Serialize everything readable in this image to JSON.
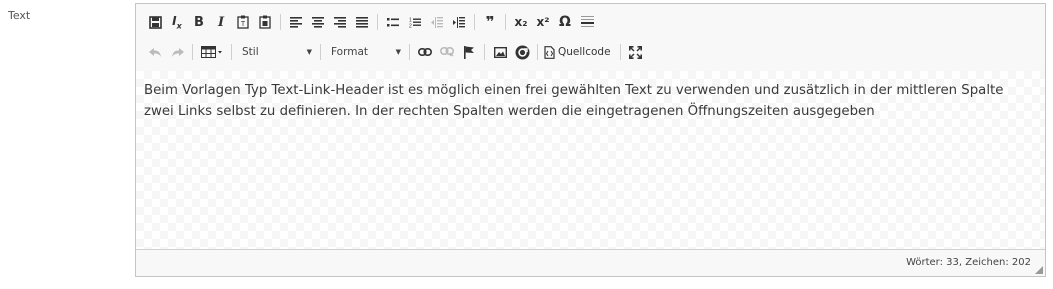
{
  "field": {
    "label": "Text"
  },
  "toolbar": {
    "row1": [
      {
        "name": "save-icon"
      },
      {
        "name": "remove-format-icon"
      },
      {
        "name": "bold-icon",
        "glyph": "B"
      },
      {
        "name": "italic-icon",
        "glyph": "I"
      },
      {
        "name": "paste-text-icon"
      },
      {
        "name": "paste-word-icon"
      },
      {
        "name": "align-left-icon"
      },
      {
        "name": "align-center-icon"
      },
      {
        "name": "align-right-icon"
      },
      {
        "name": "align-justify-icon"
      },
      {
        "name": "bulleted-list-icon"
      },
      {
        "name": "numbered-list-icon"
      },
      {
        "name": "outdent-icon"
      },
      {
        "name": "indent-icon"
      },
      {
        "name": "blockquote-icon",
        "glyph": "❞"
      },
      {
        "name": "subscript-icon",
        "glyph": "x₂"
      },
      {
        "name": "superscript-icon",
        "glyph": "x²"
      },
      {
        "name": "special-char-icon",
        "glyph": "Ω"
      },
      {
        "name": "horizontal-rule-icon"
      }
    ],
    "style_combo": "Stil",
    "format_combo": "Format",
    "source_label": "Quellcode"
  },
  "content": {
    "text": "Beim Vorlagen Typ Text-Link-Header ist es möglich einen frei gewählten Text zu verwenden und zusätzlich in der mittleren Spalte zwei Links selbst zu definieren. In der rechten Spalten werden die eingetragenen Öffnungszeiten ausgegeben"
  },
  "status": {
    "wordcount": "Wörter: 33, Zeichen: 202"
  }
}
